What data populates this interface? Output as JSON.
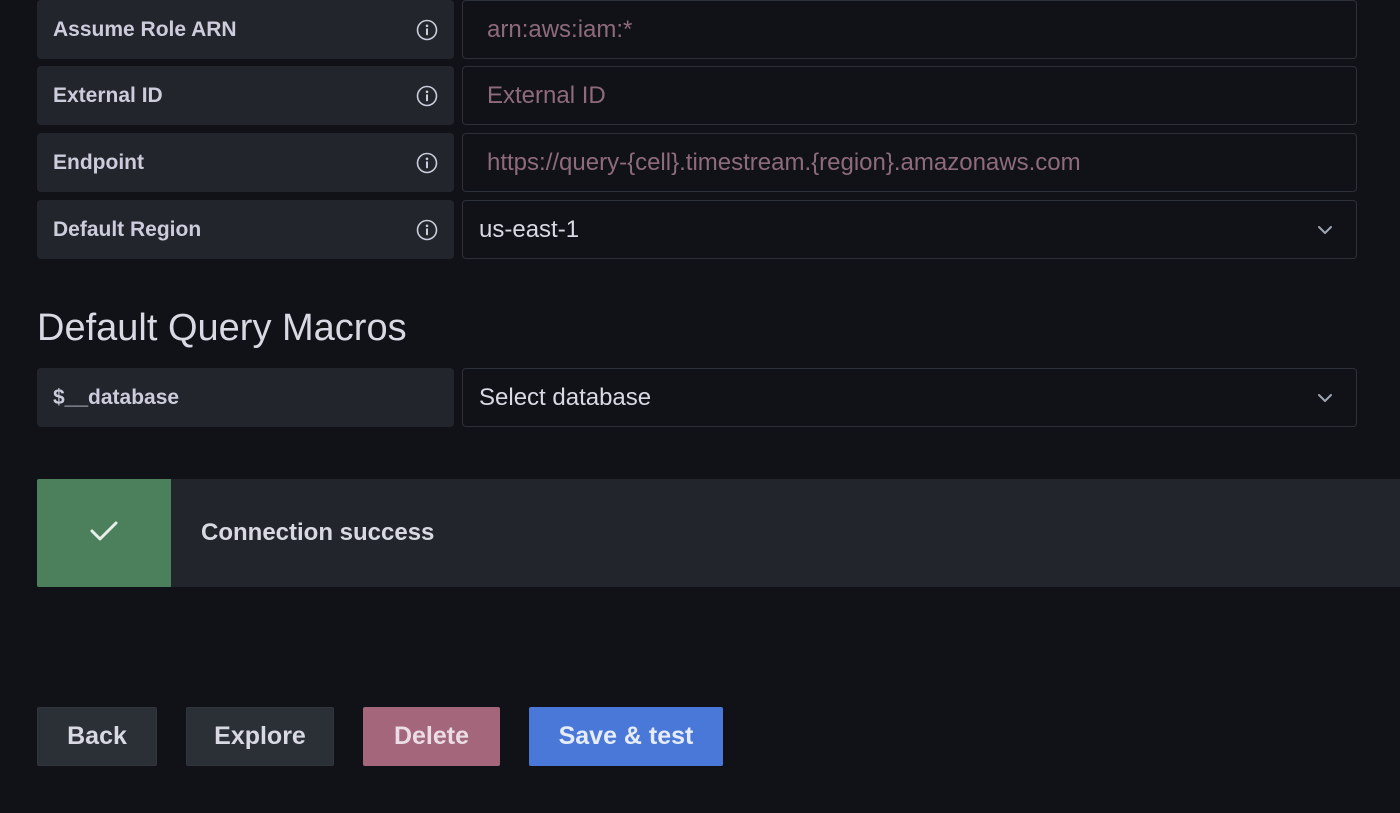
{
  "fields": [
    {
      "label": "Assume Role ARN",
      "placeholder": "arn:aws:iam:*",
      "value": ""
    },
    {
      "label": "External ID",
      "placeholder": "External ID",
      "value": ""
    },
    {
      "label": "Endpoint",
      "placeholder": "https://query-{cell}.timestream.{region}.amazonaws.com",
      "value": ""
    }
  ],
  "region": {
    "label": "Default Region",
    "selected": "us-east-1"
  },
  "macros": {
    "title": "Default Query Macros",
    "database_label": "$__database",
    "database_placeholder": "Select database"
  },
  "alert": {
    "message": "Connection success",
    "status": "success",
    "color": "#4c7f5c",
    "icon": "check-icon"
  },
  "buttons": {
    "back": "Back",
    "explore": "Explore",
    "delete": "Delete",
    "save_test": "Save & test"
  },
  "colors": {
    "primary": "#4a78d8",
    "danger": "#a3667b",
    "success": "#4c7f5c",
    "background": "#111217",
    "panel": "#22252b"
  },
  "icons": {
    "info": "info-icon",
    "chevron": "chevron-down-icon"
  }
}
